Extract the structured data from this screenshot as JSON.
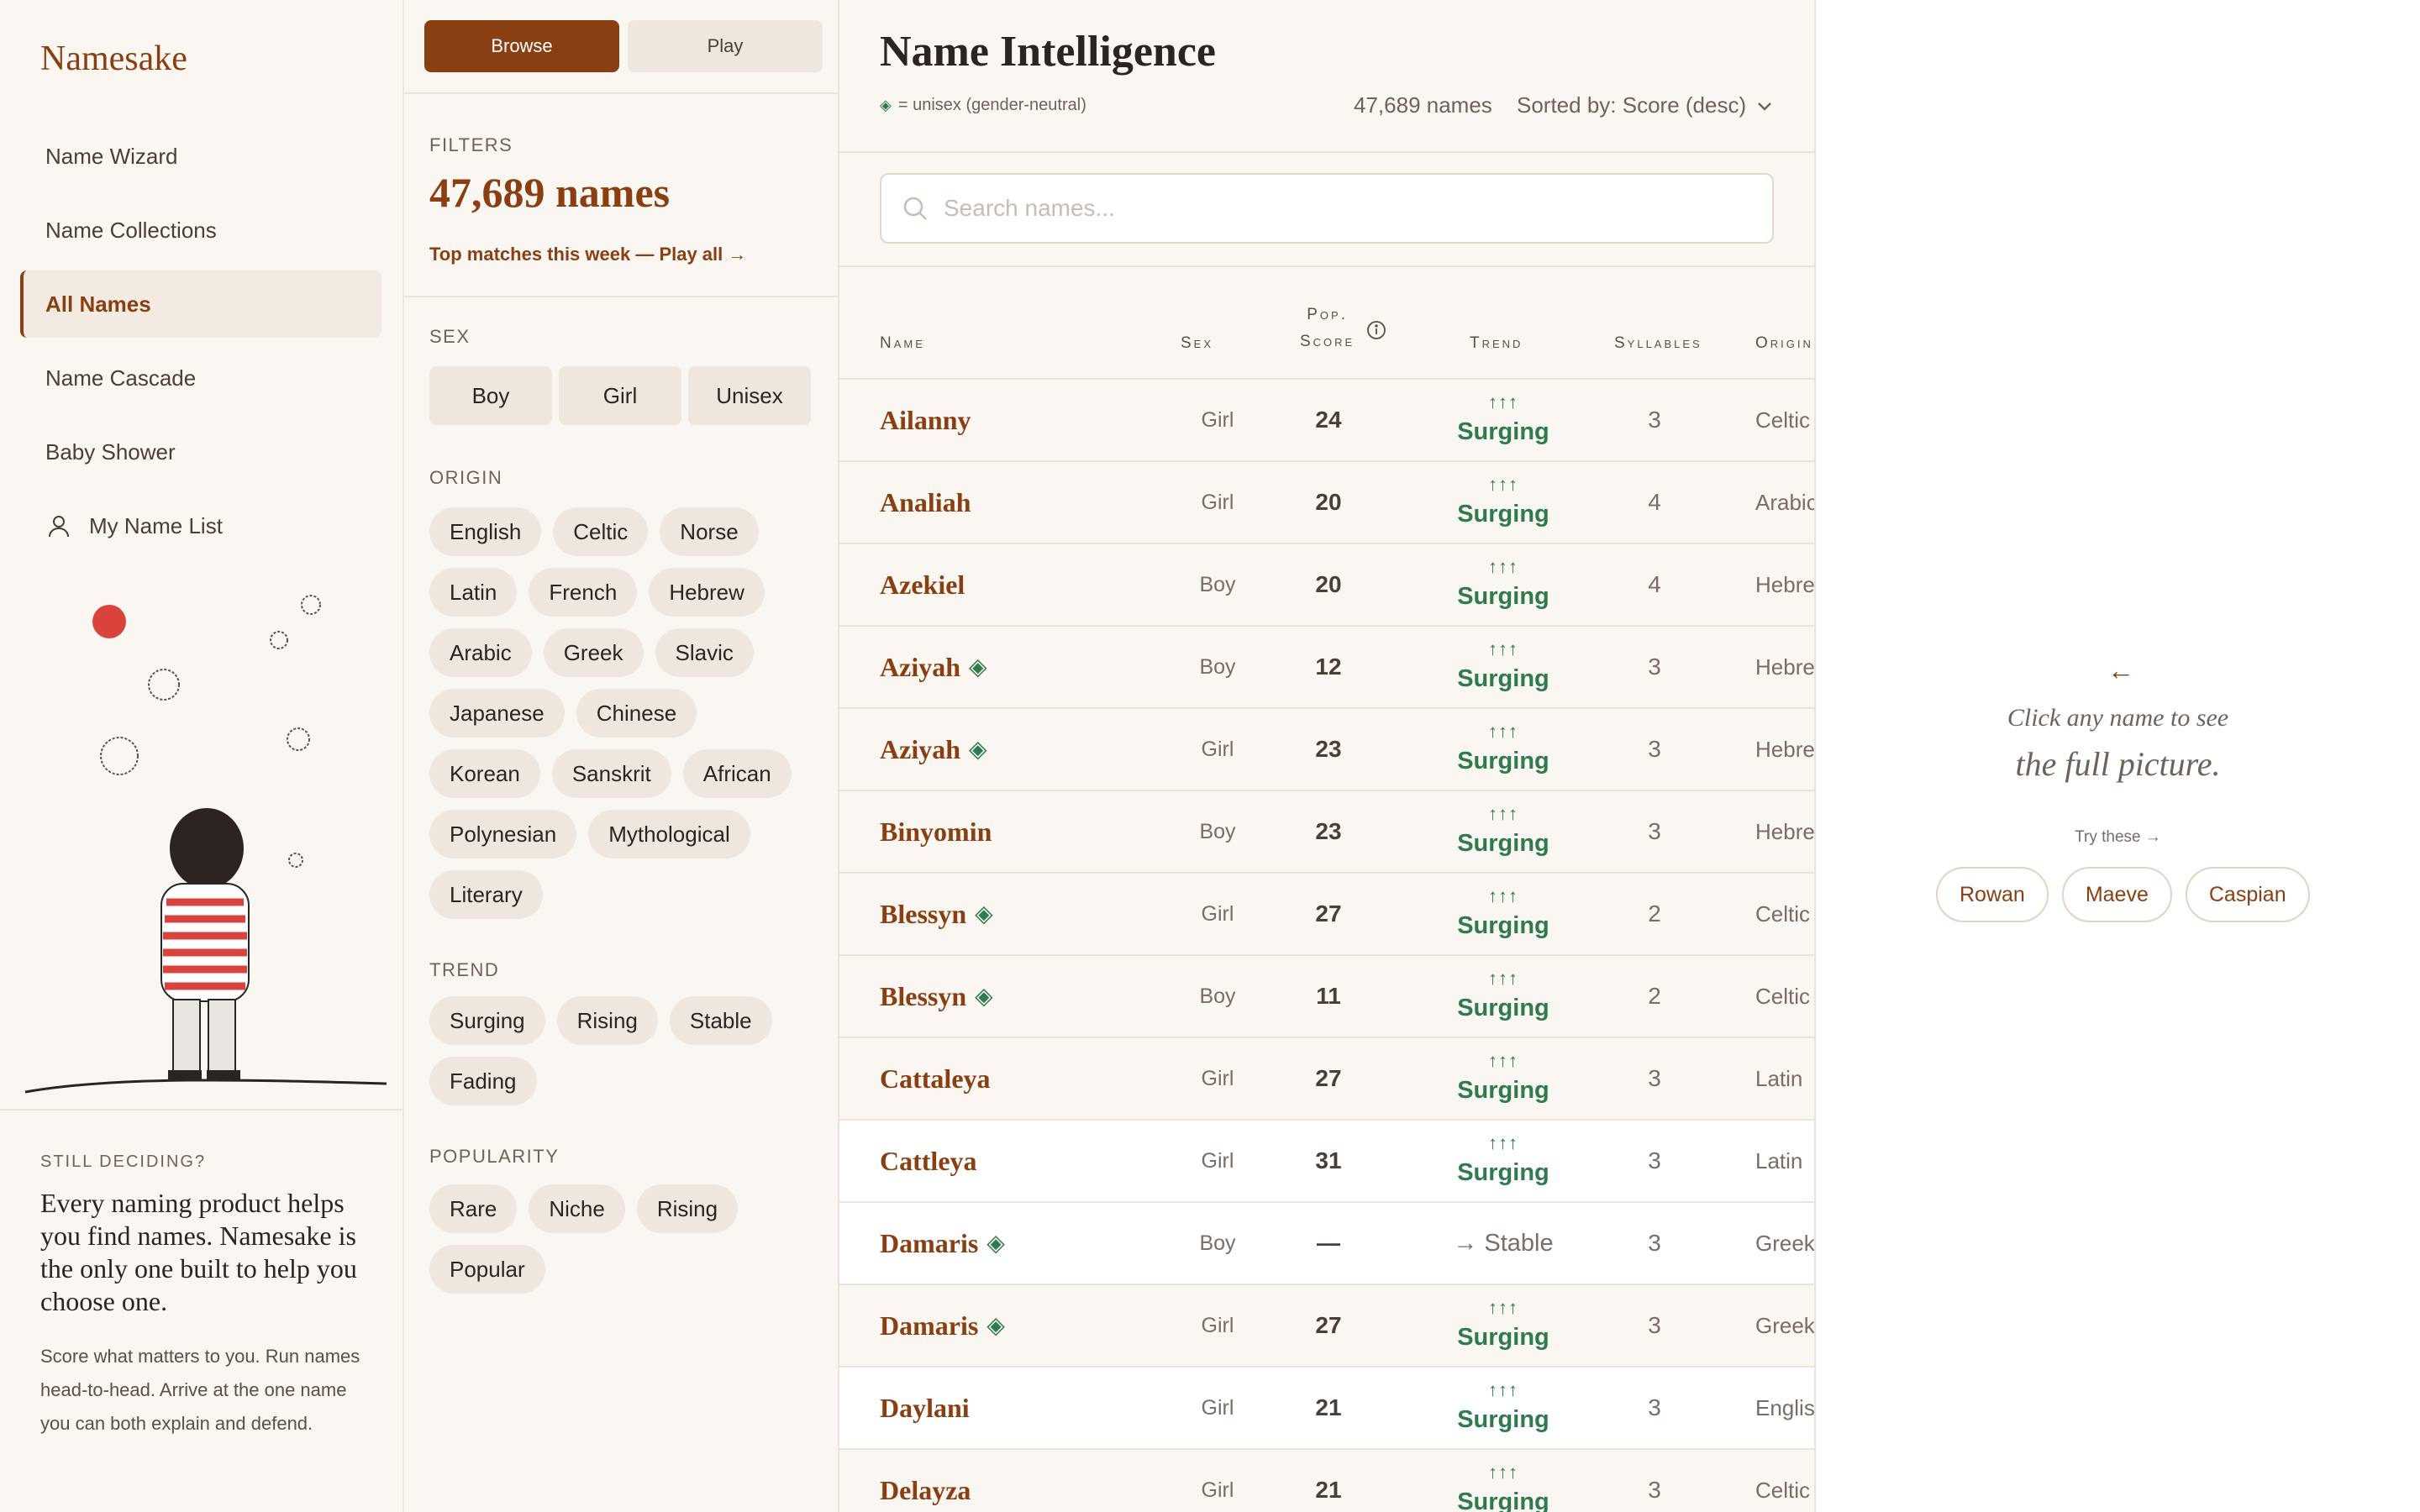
{
  "sidebar": {
    "brand": "Namesake",
    "nav": [
      {
        "label": "Name Wizard"
      },
      {
        "label": "Name Collections"
      },
      {
        "label": "All Names"
      },
      {
        "label": "Name Cascade"
      },
      {
        "label": "Baby Shower"
      },
      {
        "label": "My Name List"
      }
    ],
    "still": {
      "label": "STILL DECIDING?",
      "headline": "Every naming product helps you find names. Namesake is the only one built to help you choose one.",
      "body": "Score what matters to you. Run names head-to-head. Arrive at the one name you can both explain and defend."
    }
  },
  "filters": {
    "tabs": [
      "Browse",
      "Play"
    ],
    "label": "FILTERS",
    "count": "47,689 names",
    "link": "Top matches this week — Play all →",
    "sex": {
      "label": "SEX",
      "options": [
        "Boy",
        "Girl",
        "Unisex"
      ]
    },
    "origin": {
      "label": "ORIGIN",
      "options": [
        "English",
        "Celtic",
        "Norse",
        "Latin",
        "French",
        "Hebrew",
        "Arabic",
        "Greek",
        "Slavic",
        "Japanese",
        "Chinese",
        "Korean",
        "Sanskrit",
        "African",
        "Polynesian",
        "Mythological",
        "Literary"
      ]
    },
    "trend": {
      "label": "TREND",
      "options": [
        "Surging",
        "Rising",
        "Stable",
        "Fading"
      ]
    },
    "popularity": {
      "label": "POPULARITY",
      "options": [
        "Rare",
        "Niche",
        "Rising",
        "Popular"
      ]
    }
  },
  "main": {
    "title": "Name Intelligence",
    "legend": "= unisex (gender-neutral)",
    "count": "47,689 names",
    "sort": "Sorted by: Score (desc)",
    "search_placeholder": "Search names...",
    "columns": {
      "name": "Name",
      "sex": "Sex",
      "pop_line1": "Pop.",
      "pop_line2": "Score",
      "trend": "Trend",
      "syllables": "Syllables",
      "origin": "Origin"
    },
    "rows": [
      {
        "name": "Ailanny",
        "unisex": false,
        "sex": "Girl",
        "score": "24",
        "arrows": "↑↑↑",
        "trend": "Surging",
        "syllables": "3",
        "origin": "Celtic"
      },
      {
        "name": "Analiah",
        "unisex": false,
        "sex": "Girl",
        "score": "20",
        "arrows": "↑↑↑",
        "trend": "Surging",
        "syllables": "4",
        "origin": "Arabic"
      },
      {
        "name": "Azekiel",
        "unisex": false,
        "sex": "Boy",
        "score": "20",
        "arrows": "↑↑↑",
        "trend": "Surging",
        "syllables": "4",
        "origin": "Hebrew"
      },
      {
        "name": "Aziyah",
        "unisex": true,
        "sex": "Boy",
        "score": "12",
        "arrows": "↑↑↑",
        "trend": "Surging",
        "syllables": "3",
        "origin": "Hebrew"
      },
      {
        "name": "Aziyah",
        "unisex": true,
        "sex": "Girl",
        "score": "23",
        "arrows": "↑↑↑",
        "trend": "Surging",
        "syllables": "3",
        "origin": "Hebrew"
      },
      {
        "name": "Binyomin",
        "unisex": false,
        "sex": "Boy",
        "score": "23",
        "arrows": "↑↑↑",
        "trend": "Surging",
        "syllables": "3",
        "origin": "Hebrew"
      },
      {
        "name": "Blessyn",
        "unisex": true,
        "sex": "Girl",
        "score": "27",
        "arrows": "↑↑↑",
        "trend": "Surging",
        "syllables": "2",
        "origin": "Celtic"
      },
      {
        "name": "Blessyn",
        "unisex": true,
        "sex": "Boy",
        "score": "11",
        "arrows": "↑↑↑",
        "trend": "Surging",
        "syllables": "2",
        "origin": "Celtic"
      },
      {
        "name": "Cattaleya",
        "unisex": false,
        "sex": "Girl",
        "score": "27",
        "arrows": "↑↑↑",
        "trend": "Surging",
        "syllables": "3",
        "origin": "Latin"
      },
      {
        "name": "Cattleya",
        "unisex": false,
        "sex": "Girl",
        "score": "31",
        "arrows": "↑↑↑",
        "trend": "Surging",
        "syllables": "3",
        "origin": "Latin"
      },
      {
        "name": "Damaris",
        "unisex": true,
        "sex": "Boy",
        "score": "—",
        "arrows": "",
        "trend": "→ Stable",
        "syllables": "3",
        "origin": "Greek"
      },
      {
        "name": "Damaris",
        "unisex": true,
        "sex": "Girl",
        "score": "27",
        "arrows": "↑↑↑",
        "trend": "Surging",
        "syllables": "3",
        "origin": "Greek"
      },
      {
        "name": "Daylani",
        "unisex": false,
        "sex": "Girl",
        "score": "21",
        "arrows": "↑↑↑",
        "trend": "Surging",
        "syllables": "3",
        "origin": "English"
      },
      {
        "name": "Delayza",
        "unisex": false,
        "sex": "Girl",
        "score": "21",
        "arrows": "↑↑↑",
        "trend": "Surging",
        "syllables": "3",
        "origin": "Celtic"
      }
    ]
  },
  "detail": {
    "arrow": "←",
    "line1": "Click any name to see",
    "line2": "the full picture.",
    "try": "Try these →",
    "suggestions": [
      "Rowan",
      "Maeve",
      "Caspian"
    ]
  },
  "colors": {
    "accent": "#8a3f12",
    "surging": "#2f7a4e",
    "background": "#faf6f1"
  }
}
